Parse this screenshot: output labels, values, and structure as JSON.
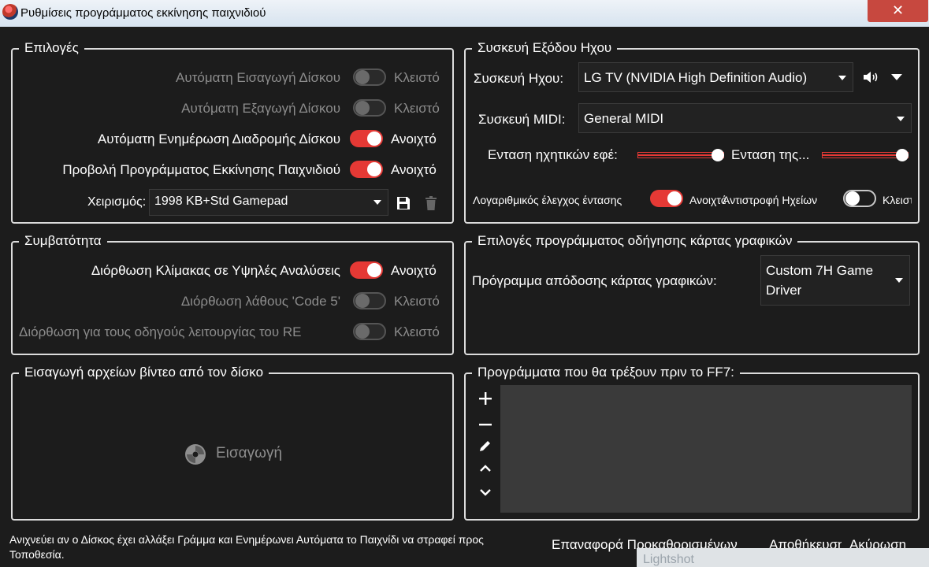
{
  "window": {
    "title": "Ρυθμίσεις προγράμματος εκκίνησης παιχνιδιού",
    "close_label": "✕"
  },
  "options": {
    "title": "Επιλογές",
    "rows": [
      {
        "label": "Αυτόματη Εισαγωγή Δίσκου",
        "state": "Κλειστό",
        "on": false,
        "enabled": false
      },
      {
        "label": "Αυτόματη Εξαγωγή Δίσκου",
        "state": "Κλειστό",
        "on": false,
        "enabled": false
      },
      {
        "label": "Αυτόματη Ενημέρωση Διαδρομής Δίσκου",
        "state": "Ανοιχτό",
        "on": true,
        "enabled": true
      },
      {
        "label": "Προβολή Προγράμματος Εκκίνησης Παιχνιδιού",
        "state": "Ανοιχτό",
        "on": true,
        "enabled": true
      }
    ],
    "control_label": "Χειρισμός:",
    "control_value": "1998 KB+Std Gamepad",
    "save_icon": "save-icon",
    "delete_icon": "trash-icon"
  },
  "audio": {
    "title": "Συσκευή Εξόδου Ηχου",
    "device_label": "Συσκευή Ηχου:",
    "device_value": "LG TV (NVIDIA High Definition Audio)",
    "midi_label": "Συσκευή MIDI:",
    "midi_value": "General MIDI",
    "sfx_label": "Ενταση ηχητικών εφέ:",
    "sfx_level": 1.0,
    "music_label": "Ενταση της...",
    "music_level": 1.0,
    "log_label": "Λογαριθμικός έλεγχος έντασης",
    "log_state": "Ανοιχτό",
    "log_on": true,
    "reverse_label": "Αντιστροφή Ηχείων",
    "reverse_state": "Κλειστό",
    "reverse_on": false
  },
  "compat": {
    "title": "Συμβατότητα",
    "rows": [
      {
        "label": "Διόρθωση Κλίμακας σε Υψηλές Αναλύσεις",
        "state": "Ανοιχτό",
        "on": true,
        "enabled": true
      },
      {
        "label": "Διόρθωση λάθους 'Code 5'",
        "state": "Κλειστό",
        "on": false,
        "enabled": false
      },
      {
        "label": "Διόρθωση για τους οδηγούς λειτουργίας του RE",
        "state": "Κλειστό",
        "on": false,
        "enabled": false
      }
    ]
  },
  "graphics": {
    "title": "Επιλογές προγράμματος οδήγησης κάρτας γραφικών",
    "renderer_label": "Πρόγραμμα απόδοσης κάρτας γραφικών:",
    "renderer_value_line1": "Custom 7H Game",
    "renderer_value_line2": "Driver"
  },
  "movies": {
    "title": "Εισαγωγή αρχείων βίντεο από τον δίσκο",
    "import_label": "Εισαγωγή"
  },
  "programs": {
    "title": "Προγράμματα που θα τρέξουν πριν το FF7:"
  },
  "footer": {
    "help_line1": "Ανιχνεύει αν ο Δίσκος έχει αλλάξει Γράμμα και Ενημέρωνει Αυτόματα το Παιχνίδι να στραφεί προς",
    "help_line2": "Τοποθεσία.",
    "reset_label": "Επαναφορά Προκαθορισμένων",
    "save_label": "Αποθήκευση",
    "cancel_label": "Ακύρωση",
    "overlay_label": "Lightshot"
  }
}
